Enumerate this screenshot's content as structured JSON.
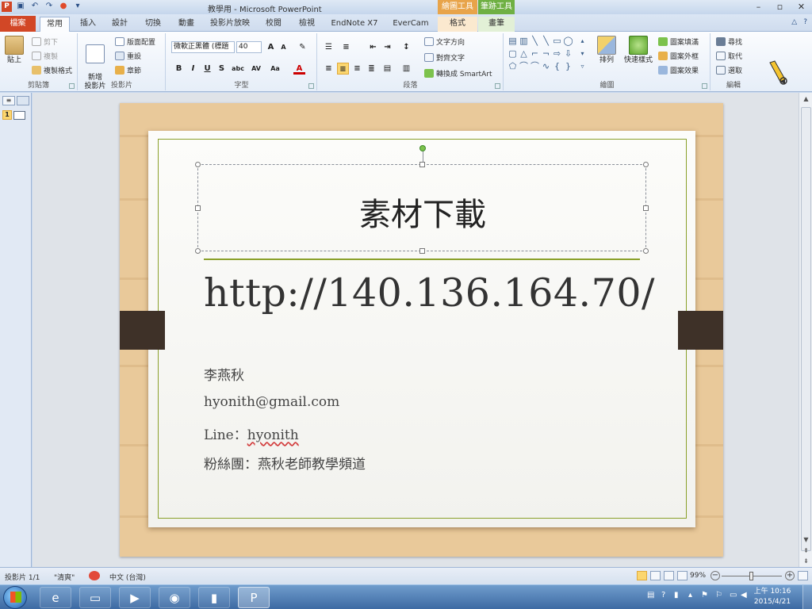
{
  "titlebar": {
    "title": "教學用 - Microsoft PowerPoint",
    "app_icon": "P",
    "context_drawing": "繪圖工具",
    "context_pen": "筆跡工具",
    "window_buttons": [
      "–",
      "▫",
      "✕"
    ]
  },
  "tabs": {
    "file": "檔案",
    "items": [
      "常用",
      "插入",
      "設計",
      "切換",
      "動畫",
      "投影片放映",
      "校閱",
      "檢視",
      "EndNote X7",
      "EverCam",
      "格式",
      "畫筆"
    ]
  },
  "ribbon": {
    "clipboard": {
      "label": "剪貼簿",
      "paste": "貼上",
      "cut": "剪下",
      "copy": "複製",
      "format_painter": "複製格式"
    },
    "slides": {
      "label": "投影片",
      "new_slide": "新增\n投影片",
      "layout": "版面配置",
      "reset": "重設",
      "section": "章節"
    },
    "font": {
      "label": "字型",
      "font_name": "微軟正黑體 (標題",
      "font_size": "40",
      "bold": "B",
      "italic": "I",
      "underline": "U",
      "strike": "S",
      "shadow": "abc",
      "spacing": "AV",
      "case": "Aa",
      "color": "A",
      "grow": "A",
      "shrink": "A"
    },
    "paragraph": {
      "label": "段落",
      "text_direction": "文字方向",
      "align_text": "對齊文字",
      "smartart": "轉換成 SmartArt"
    },
    "drawing": {
      "label": "繪圖",
      "arrange": "排列",
      "quick_styles": "快速樣式",
      "shape_fill": "圖案填滿",
      "shape_outline": "圖案外框",
      "shape_effects": "圖案效果"
    },
    "editing": {
      "label": "編輯",
      "find": "尋找",
      "replace": "取代",
      "select": "選取"
    }
  },
  "slide": {
    "title": "素材下載",
    "url": "http://140.136.164.70/",
    "name": "李燕秋",
    "email": "hyonith@gmail.com",
    "line_prefix": "Line：",
    "line_id": "hyonith",
    "fanpage": "粉絲團：燕秋老師教學頻道"
  },
  "statusbar": {
    "slide_count": "投影片 1/1",
    "theme": "\"清爽\"",
    "language": "中文 (台灣)",
    "zoom": "99%"
  },
  "taskbar": {
    "time": "上午 10:16",
    "date": "2015/4/21"
  },
  "colors": {
    "accent_file_tab": "#d24726",
    "title_border_green": "#8aa02a",
    "wood": "#e9c99a",
    "clip_brown": "#3e3128"
  }
}
